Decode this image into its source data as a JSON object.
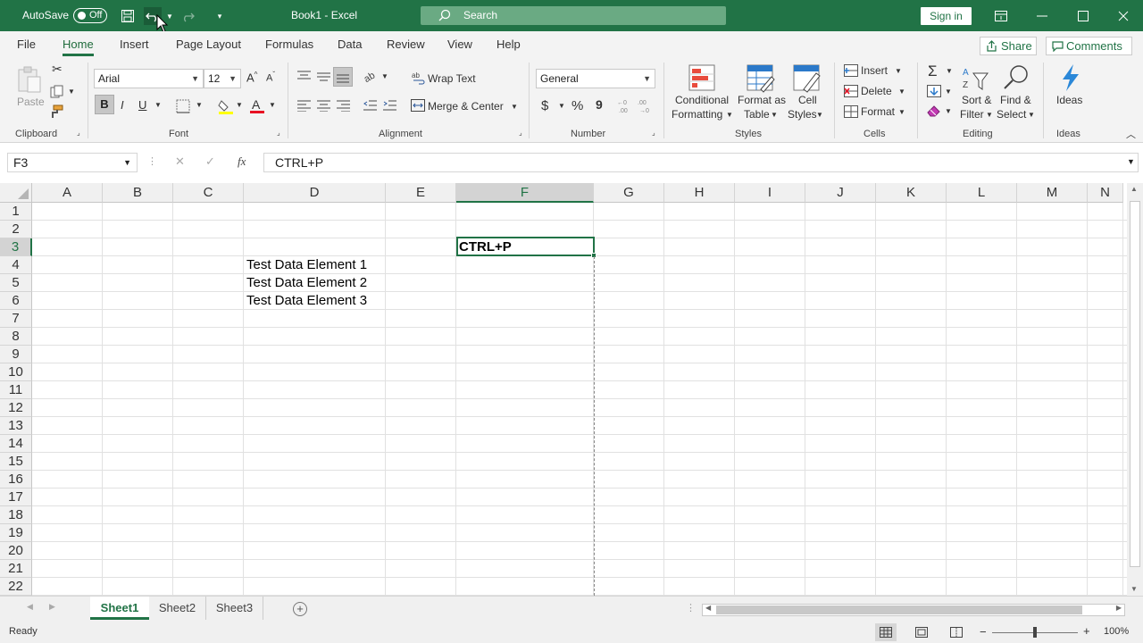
{
  "title_bar": {
    "autosave_label": "AutoSave",
    "autosave_state": "Off",
    "doc_title": "Book1  -  Excel",
    "search_placeholder": "Search",
    "sign_in": "Sign in",
    "accent": "#217346"
  },
  "tabs": [
    "File",
    "Home",
    "Insert",
    "Page Layout",
    "Formulas",
    "Data",
    "Review",
    "View",
    "Help"
  ],
  "share_label": "Share",
  "comments_label": "Comments",
  "ribbon": {
    "clipboard": {
      "paste": "Paste",
      "group": "Clipboard"
    },
    "font": {
      "name": "Arial",
      "size": "12",
      "bold": "B",
      "italic": "I",
      "underline": "U",
      "group": "Font"
    },
    "alignment": {
      "wrap": "Wrap Text",
      "merge": "Merge & Center",
      "group": "Alignment"
    },
    "number": {
      "format": "General",
      "currency": "$",
      "percent": "%",
      "comma": "9",
      "group": "Number"
    },
    "styles": {
      "conditional": "Conditional",
      "conditional2": "Formatting",
      "format_table": "Format as",
      "format_table2": "Table",
      "cell_styles": "Cell",
      "cell_styles2": "Styles",
      "group": "Styles"
    },
    "cells": {
      "insert": "Insert",
      "delete": "Delete",
      "format": "Format",
      "group": "Cells"
    },
    "editing": {
      "sort": "Sort &",
      "sort2": "Filter",
      "find": "Find &",
      "find2": "Select",
      "group": "Editing"
    },
    "ideas": {
      "label": "Ideas",
      "group": "Ideas"
    }
  },
  "formula_bar": {
    "name_box": "F3",
    "fx": "fx",
    "content": "CTRL+P"
  },
  "columns": [
    "A",
    "B",
    "C",
    "D",
    "E",
    "F",
    "G",
    "H",
    "I",
    "J",
    "K",
    "L",
    "M",
    "N"
  ],
  "rows": [
    "1",
    "2",
    "3",
    "4",
    "5",
    "6",
    "7",
    "8",
    "9",
    "10",
    "11",
    "12",
    "13",
    "14",
    "15",
    "16",
    "17",
    "18",
    "19",
    "20",
    "21",
    "22"
  ],
  "cells": {
    "F3": "CTRL+P",
    "D4": "Test Data Element 1",
    "D5": "Test Data Element 2",
    "D6": "Test Data Element 3"
  },
  "sheets": [
    "Sheet1",
    "Sheet2",
    "Sheet3"
  ],
  "status": {
    "ready": "Ready",
    "zoom": "100%"
  }
}
